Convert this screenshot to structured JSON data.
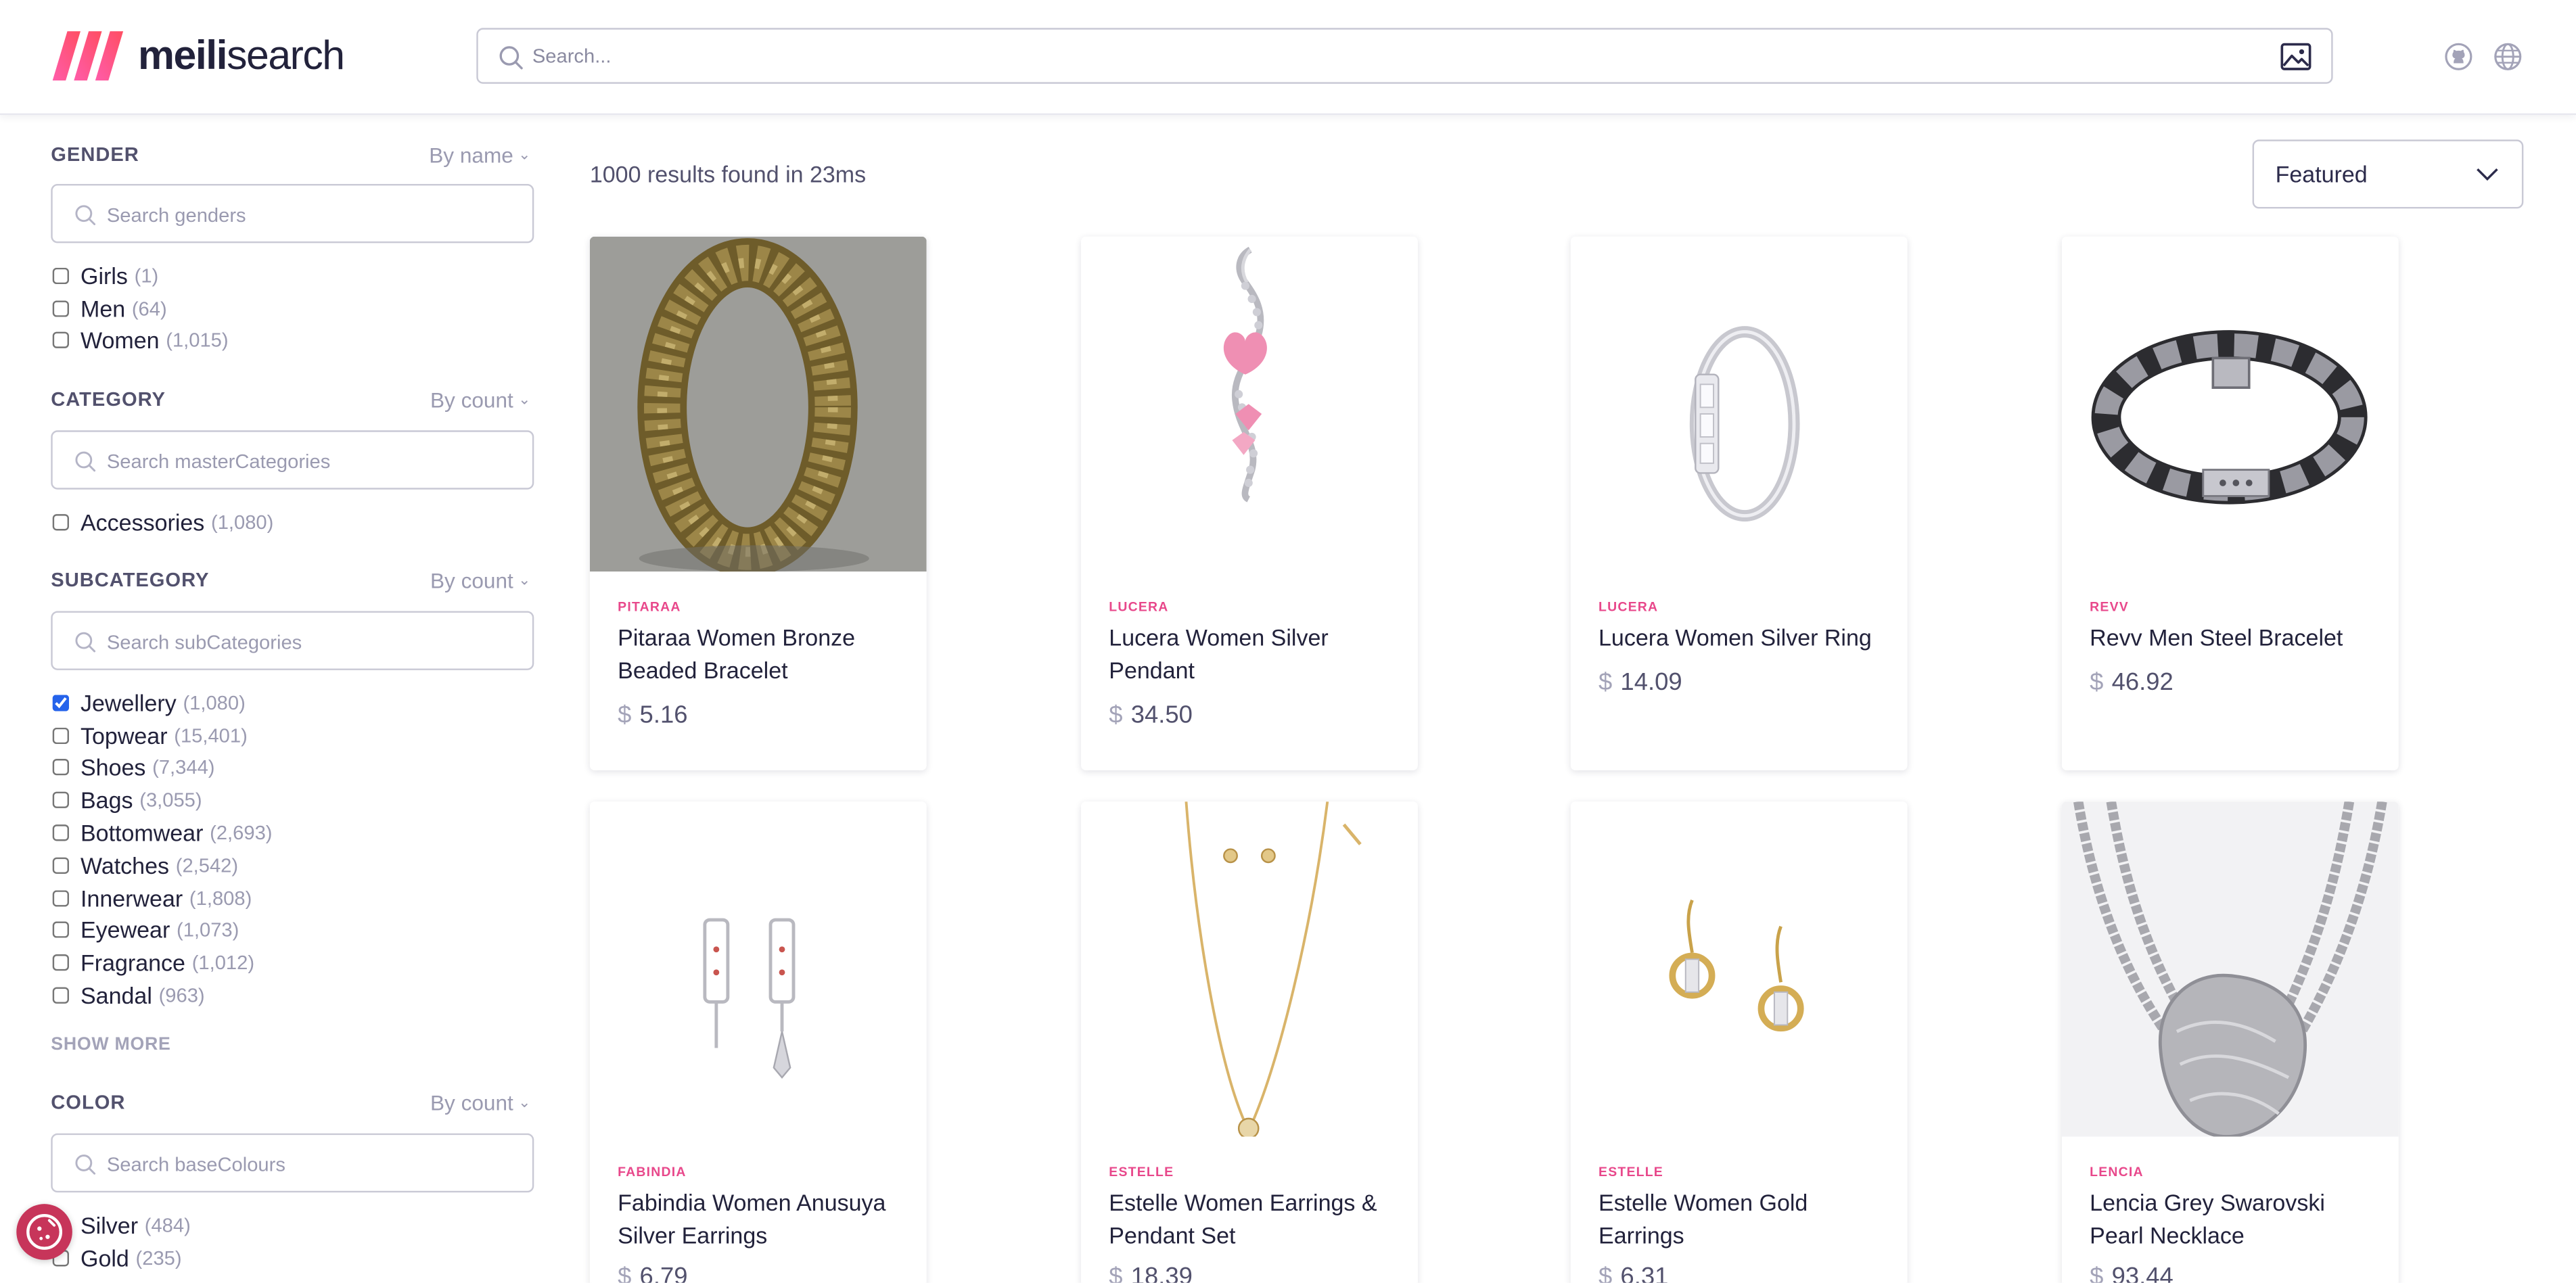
{
  "header": {
    "logo_bold": "meili",
    "logo_rest": "search",
    "search_placeholder": "Search..."
  },
  "sidebar": {
    "facets": [
      {
        "title": "GENDER",
        "sort": "By name",
        "placeholder": "Search genders",
        "items": [
          {
            "label": "Girls",
            "count": "(1)",
            "checked": false
          },
          {
            "label": "Men",
            "count": "(64)",
            "checked": false
          },
          {
            "label": "Women",
            "count": "(1,015)",
            "checked": false
          }
        ]
      },
      {
        "title": "CATEGORY",
        "sort": "By count",
        "placeholder": "Search masterCategories",
        "items": [
          {
            "label": "Accessories",
            "count": "(1,080)",
            "checked": false
          }
        ]
      },
      {
        "title": "SUBCATEGORY",
        "sort": "By count",
        "placeholder": "Search subCategories",
        "items": [
          {
            "label": "Jewellery",
            "count": "(1,080)",
            "checked": true
          },
          {
            "label": "Topwear",
            "count": "(15,401)",
            "checked": false
          },
          {
            "label": "Shoes",
            "count": "(7,344)",
            "checked": false
          },
          {
            "label": "Bags",
            "count": "(3,055)",
            "checked": false
          },
          {
            "label": "Bottomwear",
            "count": "(2,693)",
            "checked": false
          },
          {
            "label": "Watches",
            "count": "(2,542)",
            "checked": false
          },
          {
            "label": "Innerwear",
            "count": "(1,808)",
            "checked": false
          },
          {
            "label": "Eyewear",
            "count": "(1,073)",
            "checked": false
          },
          {
            "label": "Fragrance",
            "count": "(1,012)",
            "checked": false
          },
          {
            "label": "Sandal",
            "count": "(963)",
            "checked": false
          }
        ],
        "show_more": "SHOW MORE"
      },
      {
        "title": "COLOR",
        "sort": "By count",
        "placeholder": "Search baseColours",
        "items": [
          {
            "label": "Silver",
            "count": "(484)",
            "checked": false
          },
          {
            "label": "Gold",
            "count": "(235)",
            "checked": false
          }
        ]
      }
    ]
  },
  "results": {
    "count_text": "1000 results found in 23ms",
    "sort_value": "Featured"
  },
  "products": [
    {
      "brand": "PITARAA",
      "name": "Pitaraa Women Bronze Beaded Bracelet",
      "currency": "$",
      "price": "5.16"
    },
    {
      "brand": "LUCERA",
      "name": "Lucera Women Silver Pendant",
      "currency": "$",
      "price": "34.50"
    },
    {
      "brand": "LUCERA",
      "name": "Lucera Women Silver Ring",
      "currency": "$",
      "price": "14.09"
    },
    {
      "brand": "REVV",
      "name": "Revv Men Steel Bracelet",
      "currency": "$",
      "price": "46.92"
    },
    {
      "brand": "FABINDIA",
      "name": "Fabindia Women Anusuya Silver Earrings",
      "currency": "$",
      "price": "6.79"
    },
    {
      "brand": "ESTELLE",
      "name": "Estelle Women Earrings & Pendant Set",
      "currency": "$",
      "price": "18.39"
    },
    {
      "brand": "ESTELLE",
      "name": "Estelle Women Gold Earrings",
      "currency": "$",
      "price": "6.31"
    },
    {
      "brand": "LENCIA",
      "name": "Lencia Grey Swarovski Pearl Necklace",
      "currency": "$",
      "price": "93.44"
    }
  ],
  "colors": {
    "brand_pink": "#e8488b",
    "logo_pink": "#ff4e62",
    "text_dark": "#22223b",
    "muted": "#9a9ab0"
  }
}
